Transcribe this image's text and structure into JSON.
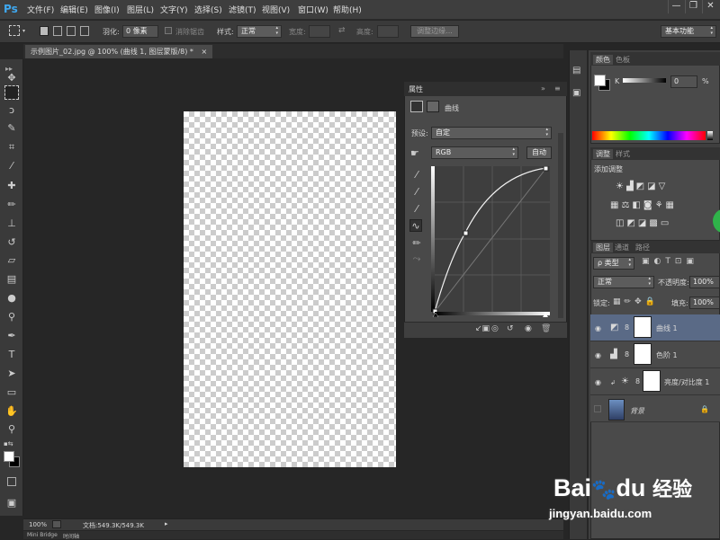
{
  "app": {
    "logo": "Ps"
  },
  "menu": {
    "items": [
      "文件(F)",
      "编辑(E)",
      "图像(I)",
      "图层(L)",
      "文字(Y)",
      "选择(S)",
      "滤镜(T)",
      "视图(V)",
      "窗口(W)",
      "帮助(H)"
    ]
  },
  "window_controls": {
    "minimize": "—",
    "restore": "❐",
    "close": "✕"
  },
  "options": {
    "feather_label": "羽化:",
    "feather_value": "0 像素",
    "antialias_label": "消除锯齿",
    "style_label": "样式:",
    "style_value": "正常",
    "width_label": "宽度:",
    "height_label": "高度:",
    "refine_button": "调整边缘...",
    "workspace": "基本功能"
  },
  "document": {
    "tab_title": "示例图片_02.jpg @ 100% (曲线 1, 图层蒙版/8) *",
    "close": "×"
  },
  "properties": {
    "title": "属性",
    "adjustment_name": "曲线",
    "preset_label": "预设:",
    "preset_value": "自定",
    "channel_value": "RGB",
    "auto_button": "自动"
  },
  "color_panel": {
    "tabs": [
      "颜色",
      "色板"
    ],
    "k_label": "K",
    "k_value": "0",
    "percent": "%"
  },
  "adjust_panel": {
    "tabs": [
      "调整",
      "样式"
    ],
    "heading": "添加调整"
  },
  "layers_panel": {
    "tabs": [
      "图层",
      "通道",
      "路径"
    ],
    "filter_value": "类型",
    "blend_mode": "正常",
    "opacity_label": "不透明度:",
    "opacity_value": "100%",
    "lock_label": "锁定:",
    "fill_label": "填充:",
    "fill_value": "100%",
    "layers": [
      {
        "name": "曲线 1",
        "selected": true
      },
      {
        "name": "色阶 1",
        "selected": false
      },
      {
        "name": "亮度/对比度 1",
        "selected": false
      },
      {
        "name": "背景",
        "selected": false
      }
    ]
  },
  "status": {
    "zoom": "100%",
    "doc_info": "文档:549.3K/549.3K",
    "bottom_tab1": "Mini Bridge",
    "bottom_tab2": "时间轴"
  },
  "watermark": {
    "brand": "Bai",
    "brand2": "du",
    "cn": "经验",
    "url": "jingyan.baidu.com"
  }
}
